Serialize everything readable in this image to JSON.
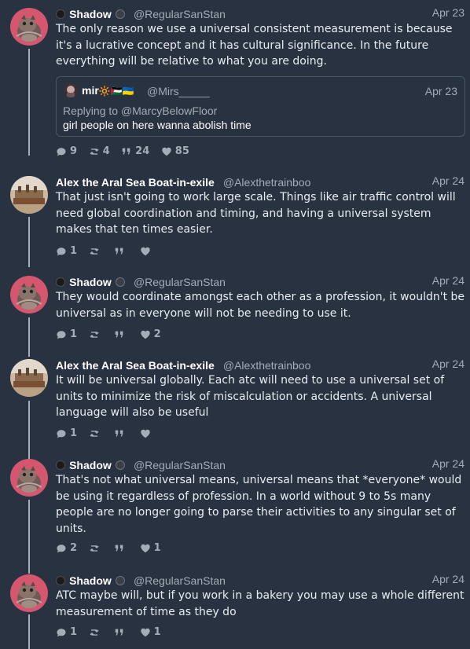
{
  "posts": [
    {
      "name": "Shadow",
      "handle": "@RegularSanStan",
      "date": "Apr 23",
      "text": "The only reason we use a universal consistent measurement is because it's a lucrative concept and it has cultural significance. In the future everything will be relative to what you are doing.",
      "replies": "9",
      "reposts": "4",
      "quotes": "24",
      "likes": "85",
      "quote": {
        "name": "mir",
        "flags": "🔆🇵🇸🇺🇦",
        "handle": "@Mirs_____",
        "date": "Apr 23",
        "replying_prefix": "Replying to ",
        "replying_to": "@MarcyBelowFloor",
        "text": "girl people on here wanna abolish time"
      }
    },
    {
      "name": "Alex the Aral Sea Boat-in-exile",
      "handle": "@Alexthetrainboo",
      "date": "Apr 24",
      "text": "That just isn't going to work large scale. Things like air traffic control will need global coordination and timing, and having a universal system makes that ten times easier.",
      "replies": "1",
      "reposts": "",
      "quotes": "",
      "likes": ""
    },
    {
      "name": "Shadow",
      "handle": "@RegularSanStan",
      "date": "Apr 24",
      "text": "They would coordinate amongst each other as a profession, it wouldn't be universal as in everyone will not be needing to use it.",
      "replies": "1",
      "reposts": "",
      "quotes": "",
      "likes": "2"
    },
    {
      "name": "Alex the Aral Sea Boat-in-exile",
      "handle": "@Alexthetrainboo",
      "date": "Apr 24",
      "text": "It will be universal globally. Each atc will need to use a universal set of units to minimize the risk of miscalculation or accidents. A universal language will also be useful",
      "replies": "1",
      "reposts": "",
      "quotes": "",
      "likes": ""
    },
    {
      "name": "Shadow",
      "handle": "@RegularSanStan",
      "date": "Apr 24",
      "text": "That's not what universal means, universal means that *everyone* would be using it regardless of profession. In a world without 9 to 5s many people are no longer going to parse their activities to any singular set of units.",
      "replies": "2",
      "reposts": "",
      "quotes": "",
      "likes": "1"
    },
    {
      "name": "Shadow",
      "handle": "@RegularSanStan",
      "date": "Apr 24",
      "text": "ATC maybe will, but if you work in a bakery you may use a whole different measurement of time as they do",
      "replies": "1",
      "reposts": "",
      "quotes": "",
      "likes": "1"
    }
  ],
  "icons": {
    "reply": "speech-bubble-icon",
    "repost": "repost-arrows-icon",
    "quote": "quote-marks-icon",
    "like": "heart-icon"
  },
  "colors": {
    "background": "#283241",
    "muted": "#a3acb7",
    "text": "#e9edf2"
  }
}
